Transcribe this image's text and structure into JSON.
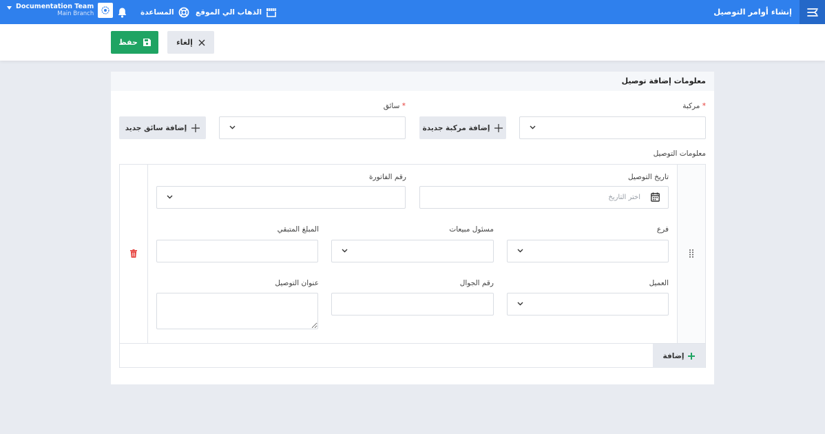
{
  "header": {
    "page_title": "إنشاء أوامر التوصيل",
    "goto_site": "الذهاب الي الموقع",
    "help": "المساعدة",
    "org_name": "Documentation Team",
    "branch": "Main Branch"
  },
  "toolbar": {
    "save_label": "حفظ",
    "cancel_label": "إلغاء"
  },
  "form": {
    "section_title": "معلومات إضافة توصيل",
    "vehicle_label": "مركبة",
    "driver_label": "سائق",
    "required_mark": "*",
    "add_vehicle_label": "إضافة مركبة جديدة",
    "add_driver_label": "إضافة سائق جديد",
    "delivery_info_label": "معلومات التوصيل",
    "fields": {
      "delivery_date": "تاريخ التوصيل",
      "date_placeholder": "اختر التاريخ",
      "invoice_number": "رقم الفاتورة",
      "branch": "فرع",
      "sales_rep": "مسئول مبيعات",
      "remaining_amount": "المبلغ المتبقي",
      "customer": "العميل",
      "mobile": "رقم الجوال",
      "delivery_address": "عنوان التوصيل"
    },
    "add_label": "إضافة"
  },
  "colors": {
    "topbar": "#2f80ed",
    "save": "#1fa463",
    "delete": "#e53935"
  }
}
